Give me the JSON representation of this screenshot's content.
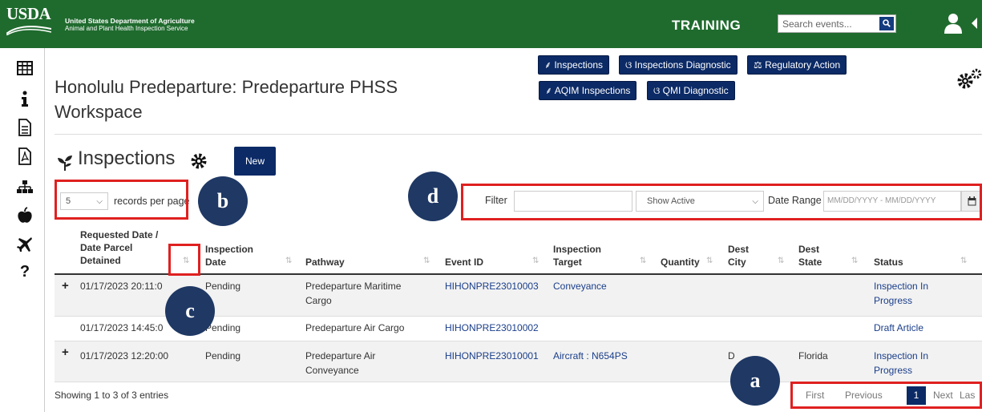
{
  "header": {
    "logo_text": "USDA",
    "agency_name": "United States Department of Agriculture",
    "agency_sub": "Animal and Plant Health Inspection Service",
    "environment": "TRAINING",
    "search_placeholder": "Search events...",
    "brand_color": "#1f6b2e"
  },
  "sidebar": {
    "icons": [
      "table-icon",
      "info-icon",
      "document-icon",
      "pdf-icon",
      "sitemap-icon",
      "apple-icon",
      "plane-icon",
      "question-icon"
    ]
  },
  "workspace": {
    "title": "Honolulu Predeparture: Predeparture PHSS Workspace",
    "nav_buttons": {
      "inspections": "Inspections",
      "inspections_diagnostic": "Inspections Diagnostic",
      "regulatory_action": "Regulatory Action",
      "aqim_inspections": "AQIM Inspections",
      "qmi_diagnostic": "QMI Diagnostic"
    }
  },
  "section": {
    "title": "Inspections",
    "new_label": "New"
  },
  "controls": {
    "records_per_page_value": "5",
    "records_per_page_label": "records per page",
    "filter_label": "Filter",
    "filter_value": "",
    "status_select_value": "Show Active",
    "date_range_label": "Date Range",
    "date_range_placeholder": "MM/DD/YYYY - MM/DD/YYYY"
  },
  "table": {
    "headers": {
      "requested": "Requested Date / Date Parcel Detained",
      "inspection_date": "Inspection Date",
      "pathway": "Pathway",
      "event_id": "Event ID",
      "inspection_target": "Inspection Target",
      "quantity": "Quantity",
      "dest_city": "Dest City",
      "dest_state": "Dest State",
      "status": "Status"
    },
    "rows": [
      {
        "expandable": true,
        "requested": "01/17/2023 20:11:0",
        "inspection_date": "Pending",
        "pathway": "Predeparture Maritime Cargo",
        "event_id": "HIHONPRE23010003",
        "inspection_target": "Conveyance",
        "quantity": "",
        "dest_city": "",
        "dest_state": "",
        "status": "Inspection In Progress"
      },
      {
        "expandable": false,
        "requested": "01/17/2023 14:45:0",
        "inspection_date": "Pending",
        "pathway": "Predeparture Air Cargo",
        "event_id": "HIHONPRE23010002",
        "inspection_target": "",
        "quantity": "",
        "dest_city": "",
        "dest_state": "",
        "status": "Draft Article"
      },
      {
        "expandable": true,
        "requested": "01/17/2023 12:20:00",
        "inspection_date": "Pending",
        "pathway": "Predeparture Air Conveyance",
        "event_id": "HIHONPRE23010001",
        "inspection_target": "Aircraft : N654PS",
        "quantity": "",
        "dest_city": "D",
        "dest_state": "Florida",
        "status": "Inspection In Progress"
      }
    ],
    "info": "Showing 1 to 3 of 3 entries"
  },
  "pagination": {
    "first": "First",
    "previous": "Previous",
    "current": "1",
    "next": "Next",
    "last": "Las"
  },
  "annotations": {
    "a": "a",
    "b": "b",
    "c": "c",
    "d": "d",
    "color": "#e02020",
    "bubble_color": "#1f3864"
  }
}
